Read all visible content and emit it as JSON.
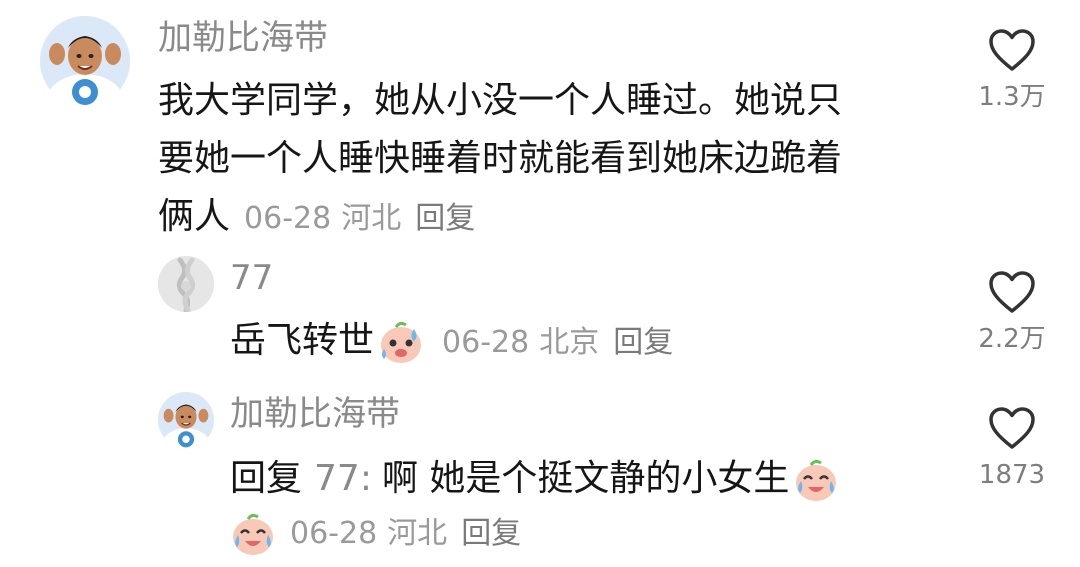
{
  "comments": [
    {
      "username": "加勒比海带",
      "text_line1": "我大学同学，她从小没一个人睡过。她说只",
      "text_line2": "要她一个人睡快睡着时就能看到她床边跪着",
      "text_line3": "俩人",
      "date": "06-28",
      "location": "河北",
      "reply_label": "回复",
      "likes": "1.3万",
      "avatar_icon": "person-waving-avatar"
    },
    {
      "username": "77",
      "text": "岳飞转世",
      "emoji_icon": "sweating-face-emoji",
      "date": "06-28",
      "location": "北京",
      "reply_label": "回复",
      "likes": "2.2万",
      "avatar_icon": "rope-knot-avatar"
    },
    {
      "username": "加勒比海带",
      "reply_prefix": "回复",
      "reply_target": "77",
      "reply_colon": ":",
      "text": "啊 她是个挺文静的小女生",
      "emoji_icon": "laughing-crying-emoji",
      "emoji2_icon": "laughing-crying-emoji",
      "date": "06-28",
      "location": "河北",
      "reply_label": "回复",
      "likes": "1873",
      "avatar_icon": "person-waving-avatar"
    }
  ],
  "colors": {
    "text": "#161616",
    "muted": "#8a8a8a",
    "heart_stroke": "#333333"
  }
}
